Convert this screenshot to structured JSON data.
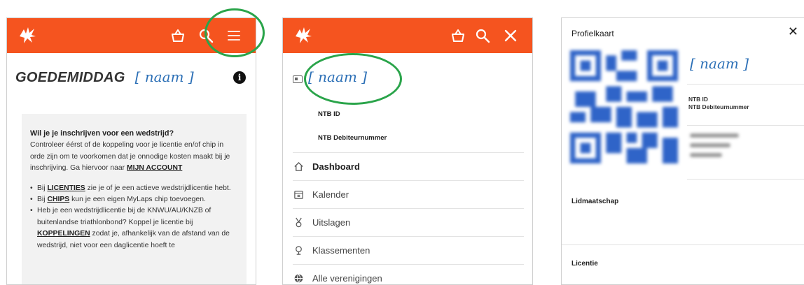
{
  "colors": {
    "brand": "#f5541f",
    "highlight_ring": "#2aa44a",
    "name_blue": "#2b6fb6"
  },
  "panel_home": {
    "topbar_icons": [
      "logo-icon",
      "basket-icon",
      "search-icon",
      "menu-icon"
    ],
    "greeting": "GOEDEMIDDAG",
    "user_name": "[ naam ]",
    "info_icon": "i",
    "notice": {
      "title": "Wil je je inschrijven voor een wedstrijd?",
      "body_pre": "Controleer éérst of de koppeling voor je licentie en/of chip in orde zijn om te voorkomen dat je onnodige kosten maakt bij je inschrijving. Ga hiervoor naar ",
      "body_link": "MIJN ACCOUNT",
      "bullets": [
        {
          "pre": "Bij ",
          "link": "LICENTIES",
          "post": " zie je of je een actieve wedstrijdlicentie hebt."
        },
        {
          "pre": "Bij ",
          "link": "CHIPS",
          "post": " kun je een eigen MyLaps chip toevoegen."
        },
        {
          "pre": "Heb je een wedstrijdlicentie bij de KNWU/AU/KNZB of buitenlandse triathlonbond? Koppel je licentie bij ",
          "link": "KOPPELINGEN",
          "post": " zodat je, afhankelijk van de afstand van de wedstrijd, niet voor een daglicentie hoeft te"
        }
      ]
    }
  },
  "panel_menu": {
    "topbar_icons": [
      "logo-icon",
      "basket-icon",
      "search-icon",
      "close-icon"
    ],
    "user_name": "[ naam ]",
    "ntb_id_label": "NTB ID",
    "debtor_label": "NTB Debiteurnummer",
    "nav": [
      {
        "label": "Dashboard",
        "icon": "home-icon"
      },
      {
        "label": "Kalender",
        "icon": "calendar-icon"
      },
      {
        "label": "Uitslagen",
        "icon": "medal-icon"
      },
      {
        "label": "Klassementen",
        "icon": "trophy-icon"
      },
      {
        "label": "Alle verenigingen",
        "icon": "globe-icon"
      }
    ]
  },
  "panel_profile": {
    "title": "Profielkaart",
    "close": "✕",
    "user_name": "[ naam ]",
    "ntb_id_label": "NTB ID",
    "debtor_label": "NTB Debiteurnummer",
    "membership_label": "Lidmaatschap",
    "license_label": "Licentie"
  }
}
